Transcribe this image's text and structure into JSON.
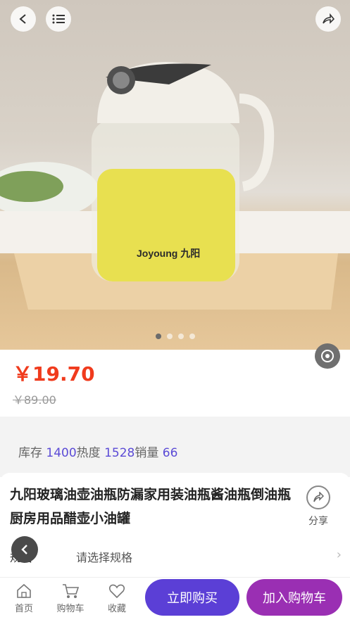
{
  "product": {
    "brand_mark": "Joyoung 九阳",
    "price": "￥19.70",
    "original_price": "￥89.00",
    "title": "九阳玻璃油壶油瓶防漏家用装油瓶酱油瓶倒油瓶厨房用品醋壶小油罐",
    "share_label": "分享"
  },
  "stats": {
    "stock_label": "库存",
    "stock_value": "1400",
    "heat_label": "热度",
    "heat_value": "1528",
    "sales_label": "销量",
    "sales_value": "66"
  },
  "spec": {
    "label": "规格",
    "value": "请选择规格"
  },
  "carousel": {
    "count": 4,
    "active_index": 0
  },
  "bottom_bar": {
    "home_label": "首页",
    "cart_label": "购物车",
    "favorite_label": "收藏",
    "buy_now_label": "立即购买",
    "add_cart_label": "加入购物车"
  },
  "colors": {
    "price": "#f03b1d",
    "accent_purple": "#5b3fd6",
    "accent_magenta": "#9a2fb3",
    "stat_value": "#5b4bd6"
  }
}
